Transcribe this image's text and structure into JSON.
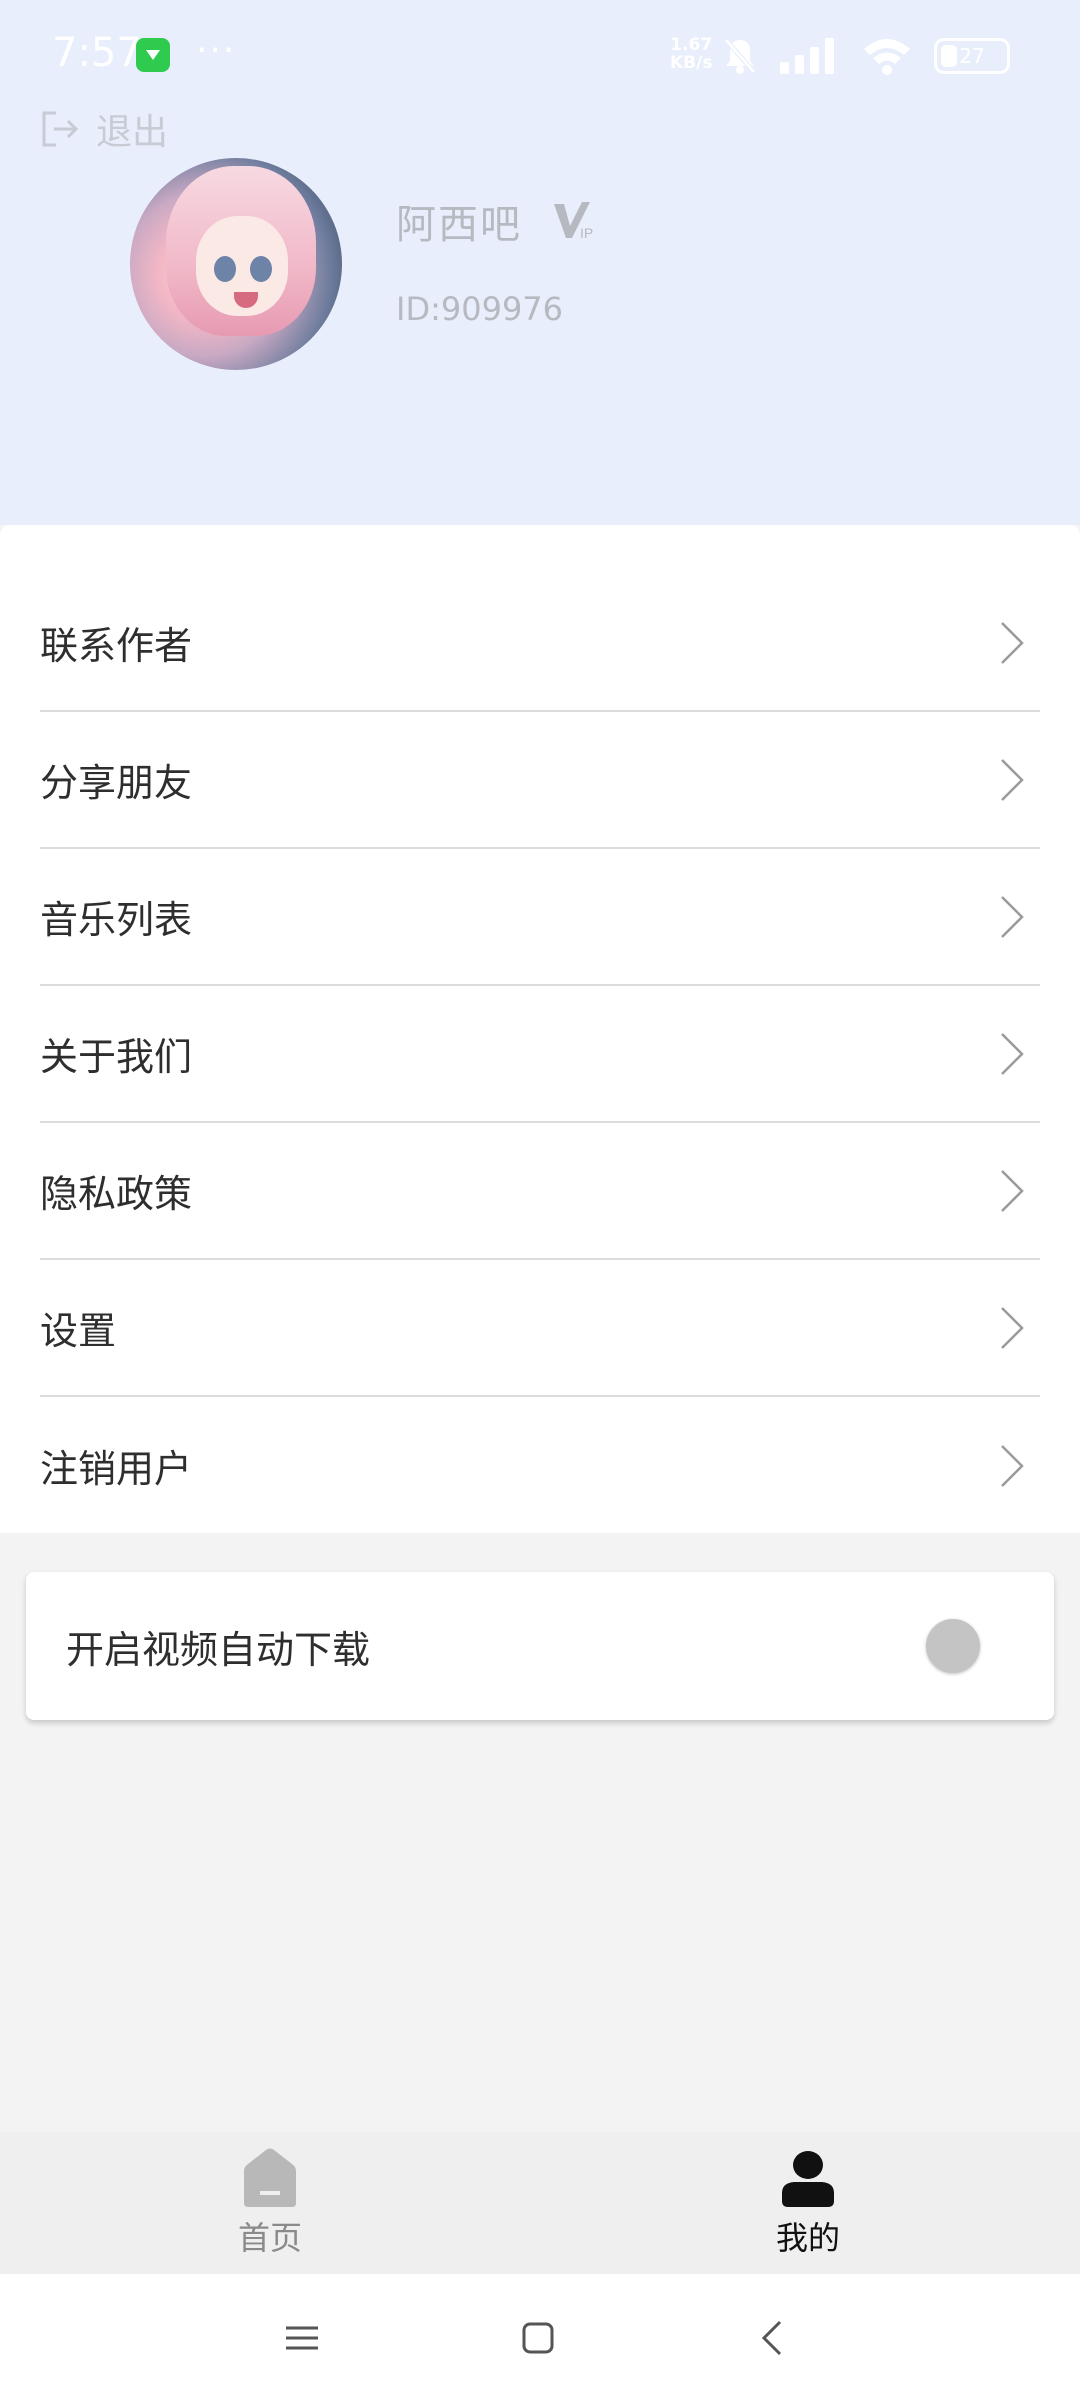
{
  "status_bar": {
    "time": "7:57",
    "more": "···",
    "net_speed_value": "1.67",
    "net_speed_unit": "KB/s",
    "battery": "27"
  },
  "header": {
    "logout_label": "退出",
    "username": "阿西吧",
    "user_id": "ID:909976",
    "badge": "VIP"
  },
  "menu": {
    "items": [
      {
        "label": "联系作者"
      },
      {
        "label": "分享朋友"
      },
      {
        "label": "音乐列表"
      },
      {
        "label": "关于我们"
      },
      {
        "label": "隐私政策"
      },
      {
        "label": "设置"
      },
      {
        "label": "注销用户"
      }
    ]
  },
  "settings": {
    "auto_download_label": "开启视频自动下载",
    "auto_download_enabled": false
  },
  "bottom_nav": {
    "tabs": [
      {
        "label": "首页",
        "icon": "home-icon",
        "active": false
      },
      {
        "label": "我的",
        "icon": "user-icon",
        "active": true
      }
    ]
  },
  "colors": {
    "header_bg": "#e8eefb",
    "page_bg": "#f3f3f3",
    "text_primary": "#2e2e2e",
    "text_muted": "#b7b9c1"
  }
}
